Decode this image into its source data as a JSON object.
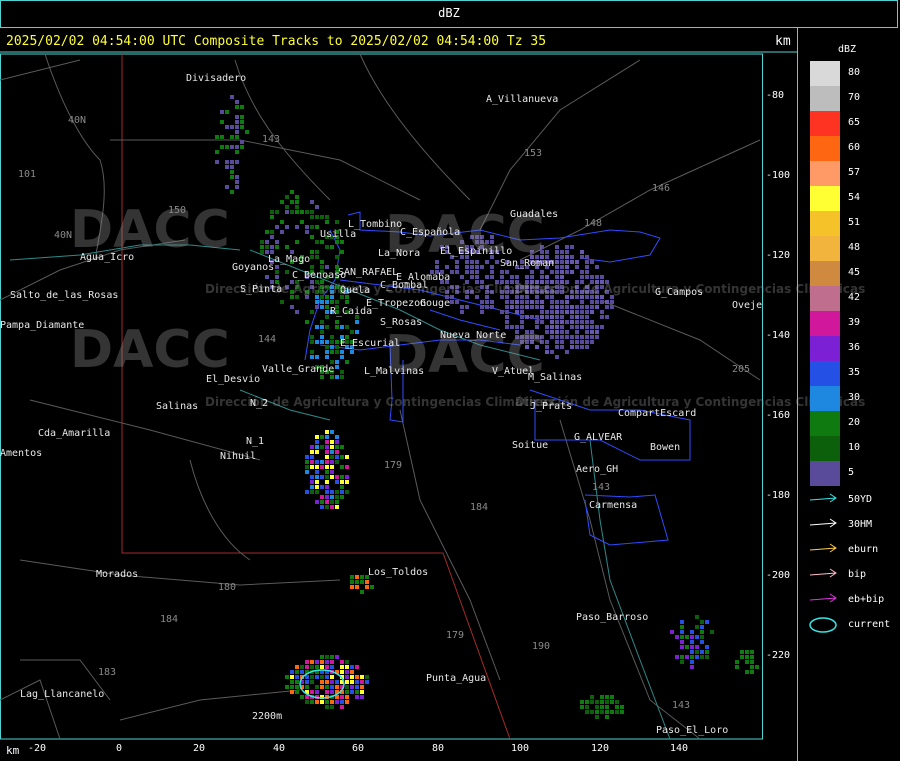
{
  "title": "dBZ",
  "header": "2025/02/02 04:54:00 UTC Composite Tracks to 2025/02/02 04:54:00 Tz 35",
  "km_label_top": "km",
  "km_label_bottom": "km",
  "legend": {
    "unit": "dBZ",
    "levels": [
      {
        "value": "80",
        "color": "#d9d9d9"
      },
      {
        "value": "70",
        "color": "#bdbdbd"
      },
      {
        "value": "65",
        "color": "#ff3322"
      },
      {
        "value": "60",
        "color": "#ff6611"
      },
      {
        "value": "57",
        "color": "#ff9966"
      },
      {
        "value": "54",
        "color": "#ffff33"
      },
      {
        "value": "51",
        "color": "#f6c22a"
      },
      {
        "value": "48",
        "color": "#f3b43d"
      },
      {
        "value": "45",
        "color": "#d08a40"
      },
      {
        "value": "42",
        "color": "#c06e8e"
      },
      {
        "value": "39",
        "color": "#d1179c"
      },
      {
        "value": "36",
        "color": "#7c20d6"
      },
      {
        "value": "35",
        "color": "#2450e6"
      },
      {
        "value": "30",
        "color": "#1e88e0"
      },
      {
        "value": "20",
        "color": "#0f7a0f"
      },
      {
        "value": "10",
        "color": "#0c600c"
      },
      {
        "value": "5",
        "color": "#5a4a9a"
      }
    ],
    "tracks": [
      {
        "label": "50YD",
        "color": "#33e6e6"
      },
      {
        "label": "30HM",
        "color": "#ffffff"
      },
      {
        "label": "eburn",
        "color": "#ffcc44"
      },
      {
        "label": "bip",
        "color": "#ffbbcc"
      },
      {
        "label": "eb+bip",
        "color": "#dd33dd"
      },
      {
        "label": "current",
        "color": "#33e6e6"
      }
    ]
  },
  "y_axis": [
    "-80",
    "-100",
    "-120",
    "-140",
    "-160",
    "-180",
    "-200",
    "-220"
  ],
  "x_axis": [
    "-20",
    "0",
    "20",
    "40",
    "60",
    "80",
    "100",
    "120",
    "140"
  ],
  "watermark": "DACC",
  "watermark_sub": "Dirección de Agricultura y Contingencias Climáticas",
  "places": [
    "Divisadero",
    "A_Villanueva",
    "Guadales",
    "L_Tombino",
    "C_Española",
    "Usilla",
    "La_Nora",
    "El_Espinillo",
    "San_Roman",
    "Agua_Icro",
    "Goyanos",
    "La_Mago",
    "C_Benoaso",
    "SAN_RAFAEL",
    "E_Alomaba",
    "C_Bombal",
    "G_Campos",
    "S_Pinta",
    "Pampa_Diamante",
    "Quela",
    "E_Tropezon",
    "Gouge",
    "R_Caida",
    "S_Rosas",
    "Nueva_Norte",
    "E_Escurial",
    "El_Desvio",
    "Valle_Grande",
    "L_Malvinas",
    "V_Atuel",
    "M_Salinas",
    "N_2",
    "N_1",
    "Nihuil",
    "J_Prats",
    "CompartEscard",
    "Salinas",
    "Cda_Amarilla",
    "Amentos",
    "G_ALVEAR",
    "Soitue",
    "Bowen",
    "Aero_GH",
    "Carmensa",
    "Morados",
    "Los_Toldos",
    "Paso_Barroso",
    "Punta_Agua",
    "Lag_Llancanelo",
    "2200m",
    "Paso_El_Loro",
    "Oveje",
    "Salto_de_las_Rosas"
  ],
  "route_numbers": [
    "143",
    "153",
    "146",
    "148",
    "101",
    "40N",
    "150",
    "40N",
    "144",
    "179",
    "184",
    "180",
    "184",
    "183",
    "179",
    "190",
    "143",
    "143",
    "205"
  ]
}
